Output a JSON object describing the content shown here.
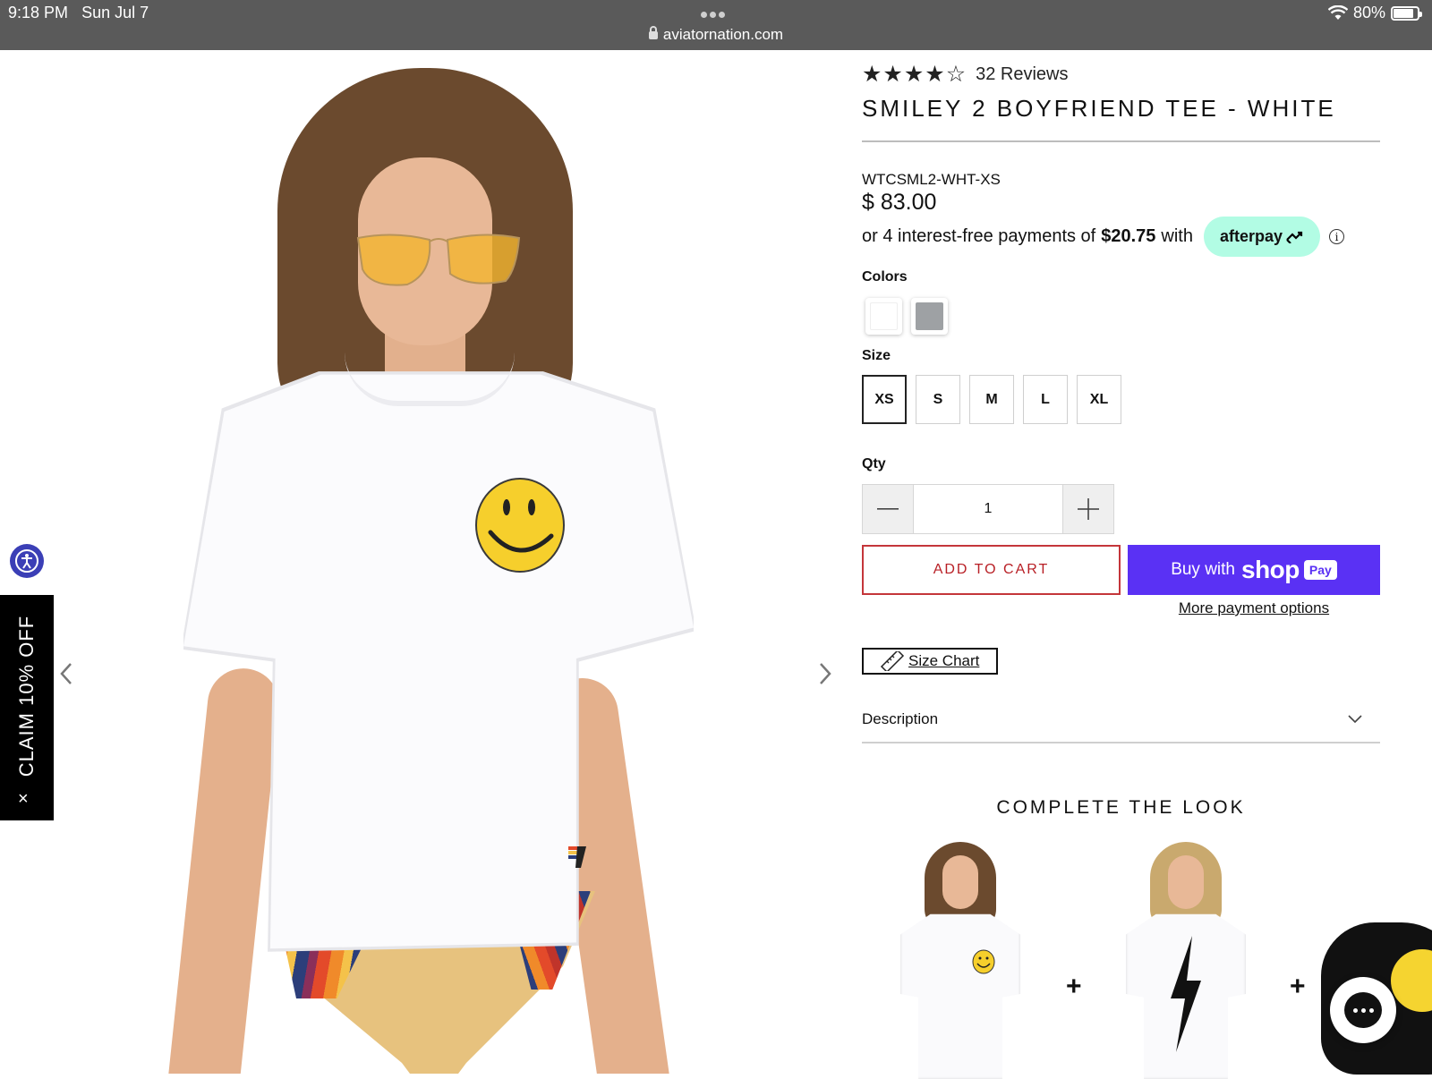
{
  "status_bar": {
    "time": "9:18 PM",
    "date": "Sun Jul 7",
    "battery": "80%",
    "battery_level": 0.8,
    "url": "aviatornation.com"
  },
  "product": {
    "rating_value": 4,
    "rating_max": 5,
    "reviews": "32 Reviews",
    "title": "SMILEY 2 BOYFRIEND TEE - WHITE",
    "sku": "WTCSML2-WHT-XS",
    "price": "$ 83.00",
    "afterpay": {
      "prefix": "or 4 interest-free payments of",
      "amount": "$20.75",
      "suffix": "with",
      "badge": "afterpay",
      "info_icon": "info-icon"
    }
  },
  "colors": {
    "label": "Colors",
    "swatches": [
      {
        "name": "White",
        "hex": "#ffffff"
      },
      {
        "name": "Grey",
        "hex": "#9ea1a4"
      }
    ]
  },
  "size": {
    "label": "Size",
    "options": [
      "XS",
      "S",
      "M",
      "L",
      "XL"
    ],
    "selected": "XS"
  },
  "qty": {
    "label": "Qty",
    "value": "1",
    "minus_icon": "minus-icon",
    "plus_icon": "plus-icon"
  },
  "actions": {
    "add_to_cart": "ADD TO CART",
    "buy_with": "Buy with",
    "shop_word": "shop",
    "pay_pill": "Pay",
    "more_payment": "More payment options",
    "size_chart": "Size Chart",
    "description": "Description"
  },
  "complete_look": {
    "title": "COMPLETE THE LOOK",
    "plus": "+"
  },
  "side": {
    "claim": "CLAIM 10% OFF",
    "close": "×"
  },
  "colors_theme": {
    "status_bar_bg": "#5a5a5a",
    "add_to_cart_red": "#c4363a",
    "shop_pay_purple": "#5a31f4",
    "afterpay_mint": "#b2fce4",
    "accessibility_blue": "#3b3fb6"
  }
}
